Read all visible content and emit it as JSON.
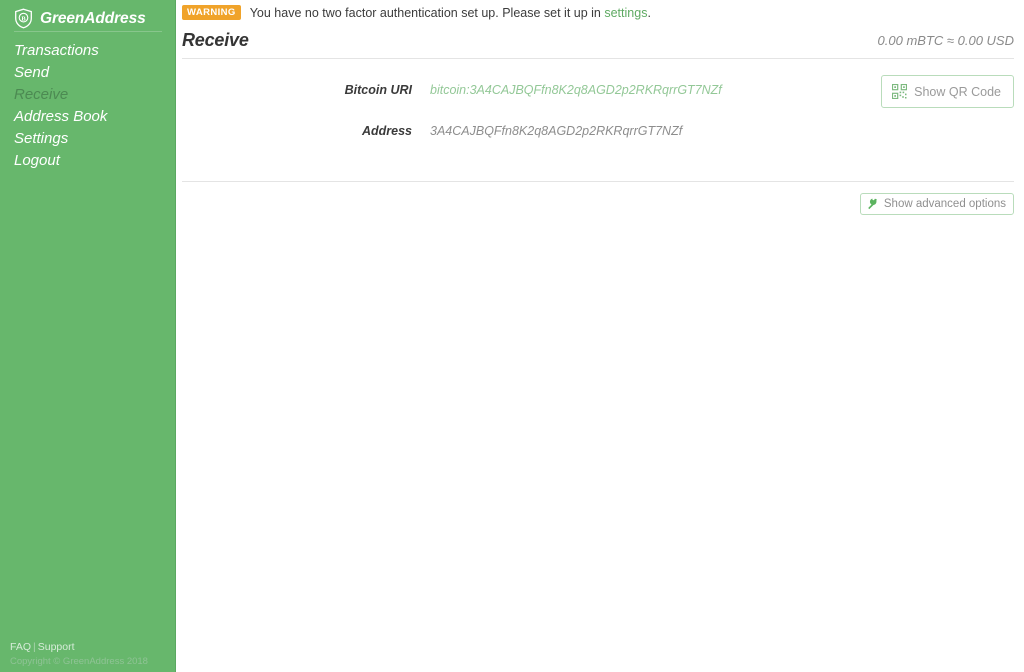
{
  "app": {
    "brand_name": "GreenAddress",
    "brand_icon": "shield-bitcoin-icon",
    "colors": {
      "sidebar_bg": "#67b76c",
      "accent_green": "#5faa63",
      "warning_orange": "#f0a32a",
      "value_green": "#93c897",
      "text_dark": "#353535"
    }
  },
  "sidebar": {
    "items": [
      {
        "label": "Transactions",
        "active": false
      },
      {
        "label": "Send",
        "active": false
      },
      {
        "label": "Receive",
        "active": true
      },
      {
        "label": "Address Book",
        "active": false
      },
      {
        "label": "Settings",
        "active": false
      },
      {
        "label": "Logout",
        "active": false
      }
    ],
    "footer": {
      "faq": "FAQ",
      "separator": "|",
      "support": "Support",
      "copyright": "Copyright © GreenAddress 2018"
    }
  },
  "warning": {
    "badge": "WARNING",
    "text_before": "You have no two factor authentication set up. Please set it up in ",
    "link": "settings",
    "text_after": "."
  },
  "header": {
    "title": "Receive",
    "balance": "0.00 mBTC ≈ 0.00 USD"
  },
  "receive": {
    "uri_label": "Bitcoin URI",
    "uri_value": "bitcoin:3A4CAJBQFfn8K2q8AGD2p2RKRqrrGT7NZf",
    "address_label": "Address",
    "address_value": "3A4CAJBQFfn8K2q8AGD2p2RKRqrrGT7NZf",
    "qr_button_label": "Show QR Code",
    "qr_button_icon": "qr-code-icon",
    "advanced_button_label": "Show advanced options",
    "advanced_button_icon": "wrench-icon"
  }
}
